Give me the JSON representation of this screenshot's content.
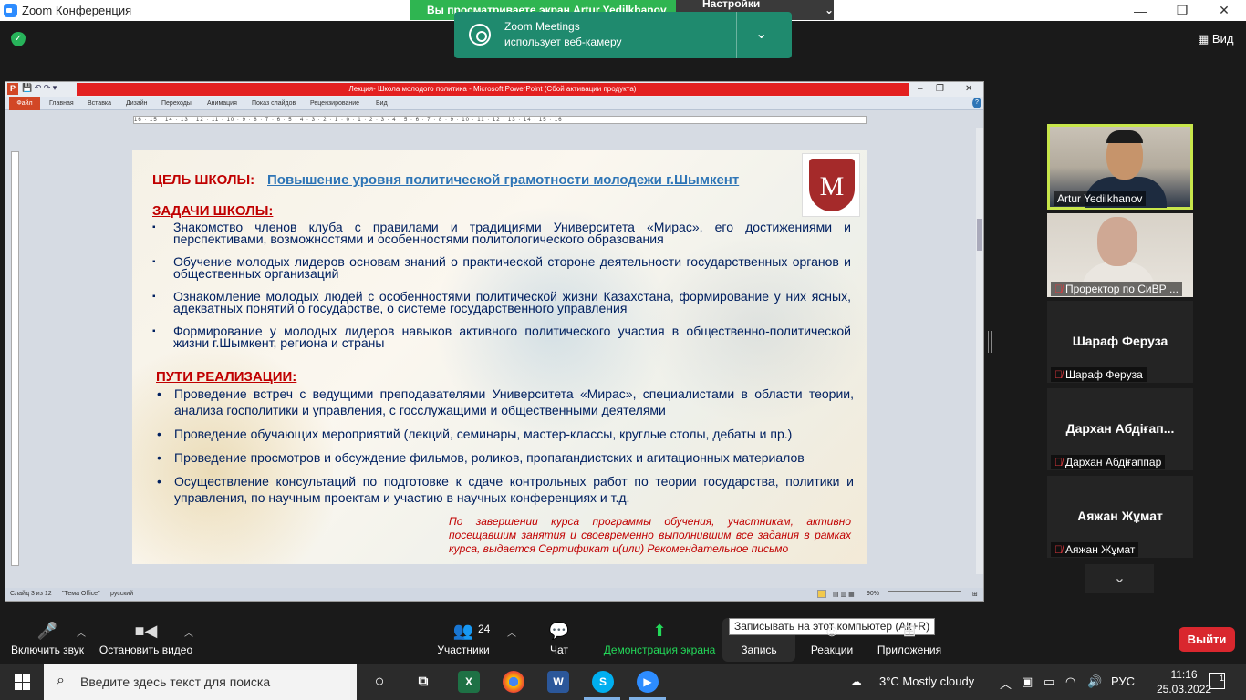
{
  "zoom": {
    "window_title": "Zoom Конференция",
    "share_banner": "Вы просматриваете экран Artur Yedilkhanov",
    "view_options": "Настройки просмотра",
    "view_button": "Вид",
    "notification": {
      "app": "Zoom Meetings",
      "message": "использует веб-камеру"
    }
  },
  "ppt": {
    "title": "Лекция- Школа молодого политика - Microsoft PowerPoint (Сбой активации продукта)",
    "tabs": [
      "Файл",
      "Главная",
      "Вставка",
      "Дизайн",
      "Переходы",
      "Анимация",
      "Показ слайдов",
      "Рецензирование",
      "Вид"
    ],
    "ruler": "16 · 15 · 14 · 13 · 12 · 11 · 10 · 9 · 8 · 7 · 6 · 5 · 4 · 3 · 2 · 1 · 0 · 1 · 2 · 3 · 4 · 5 · 6 · 7 · 8 · 9 · 10 · 11 · 12 · 13 · 14 · 15 · 16",
    "status": {
      "slide": "Слайд 3 из 12",
      "theme": "\"Тема Office\"",
      "lang": "русский",
      "zoom": "90%"
    }
  },
  "slide": {
    "goal_label": "ЦЕЛЬ ШКОЛЫ:",
    "goal_text": "Повышение уровня политической грамотности молодежи г.Шымкент",
    "tasks_label": "ЗАДАЧИ ШКОЛЫ:",
    "tasks": [
      "Знакомство членов клуба с правилами и традициями Университета «Мирас», его достижениями и перспективами, возможностями и особенностями политологического образования",
      "Обучение молодых лидеров основам знаний о практической стороне деятельности государственных органов и общественных организаций",
      "Ознакомление молодых людей с особенностями политической жизни Казахстана, формирование у них ясных, адекватных понятий о государстве, о системе государственного управления",
      "Формирование у молодых лидеров навыков активного политического участия в общественно-политической жизни г.Шымкент, региона и страны"
    ],
    "ways_label": "ПУТИ РЕАЛИЗАЦИИ:",
    "ways": [
      "Проведение встреч с ведущими преподавателями Университета «Мирас», специалистами в области теории, анализа госполитики и управления, с госслужащими и общественными деятелями",
      "Проведение обучающих мероприятий (лекций, семинары, мастер-классы, круглые столы, дебаты и пр.)",
      "Проведение просмотров и обсуждение фильмов, роликов, пропагандистских и агитационных материалов",
      "Осуществление консультаций по подготовке к сдаче контрольных работ по теории государства, политики и управления, по научным проектам и участию в научных конференциях и т.д."
    ],
    "footnote": "По завершении курса программы обучения, участникам, активно посещавшим занятия и своевременно выполнившим все задания в рамках курса, выдается Сертификат и(или) Рекомендательное письмо",
    "logo_letter": "M"
  },
  "participants": [
    {
      "name": "Artur Yedilkhanov",
      "video": true,
      "muted": false
    },
    {
      "name": "Проректор по СиВР ...",
      "video": true,
      "muted": true
    },
    {
      "name": "Шараф Феруза",
      "video": false,
      "muted": true
    },
    {
      "name": "Дархан Абдіғап...",
      "full": "Дархан Абдіғаппар",
      "video": false,
      "muted": true
    },
    {
      "name": "Аяжан Жұмат",
      "video": false,
      "muted": true
    }
  ],
  "controls": {
    "unmute": "Включить звук",
    "stop_video": "Остановить видео",
    "participants": "Участники",
    "participants_count": "24",
    "chat": "Чат",
    "share": "Демонстрация экрана",
    "record": "Запись",
    "record_tooltip": "Записывать на этот компьютер (Alt+R)",
    "reactions": "Реакции",
    "apps": "Приложения",
    "leave": "Выйти"
  },
  "taskbar": {
    "search_placeholder": "Введите здесь текст для поиска",
    "weather": "3°C  Mostly cloudy",
    "lang": "РУС",
    "time": "11:16",
    "date": "25.03.2022",
    "notifications": "1"
  }
}
